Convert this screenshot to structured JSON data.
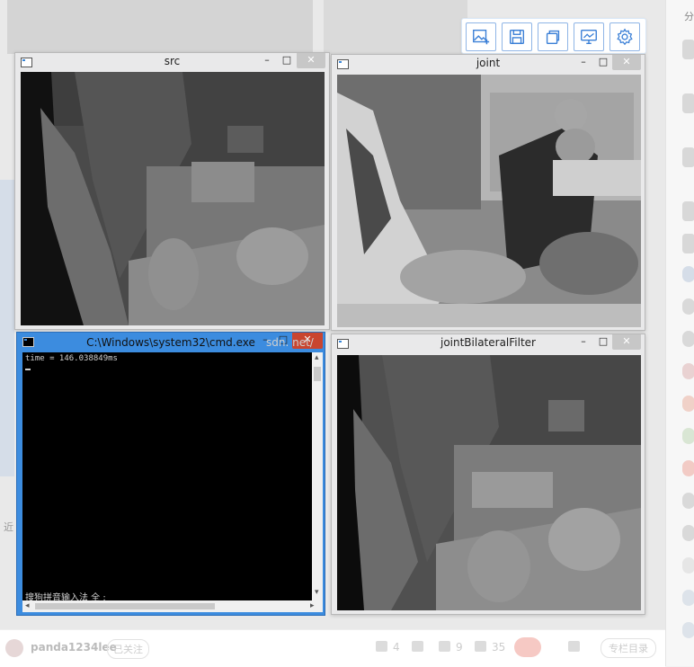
{
  "right_sidebar": {
    "label": "分"
  },
  "toolbar": {
    "buttons": [
      {
        "icon": "image-add-icon"
      },
      {
        "icon": "save-icon"
      },
      {
        "icon": "copy-icon"
      },
      {
        "icon": "screen-icon"
      },
      {
        "icon": "settings-gear-icon"
      }
    ],
    "accent": "#3a7fd6"
  },
  "windows": {
    "src": {
      "title": "src",
      "minimize": "–",
      "maximize": "□",
      "close": "✕"
    },
    "joint": {
      "title": "joint",
      "minimize": "–",
      "maximize": "□",
      "close": "✕"
    },
    "filter": {
      "title": "jointBilateralFilter",
      "minimize": "–",
      "maximize": "□",
      "close": "✕"
    },
    "cmd": {
      "title": "C:\\Windows\\system32\\cmd.exe",
      "minimize": "–",
      "maximize": "□",
      "close": "✕",
      "output": "time = 146.038849ms",
      "ime_status": "搜狗拼音输入法 全 :"
    }
  },
  "watermark": "sdn. net/",
  "left_edge_text": "近",
  "bottom_bar": {
    "username": "panda1234lee",
    "follow": "已关注",
    "likes": "4",
    "comments": "9",
    "favorites": "35",
    "column_toc": "专栏目录"
  }
}
